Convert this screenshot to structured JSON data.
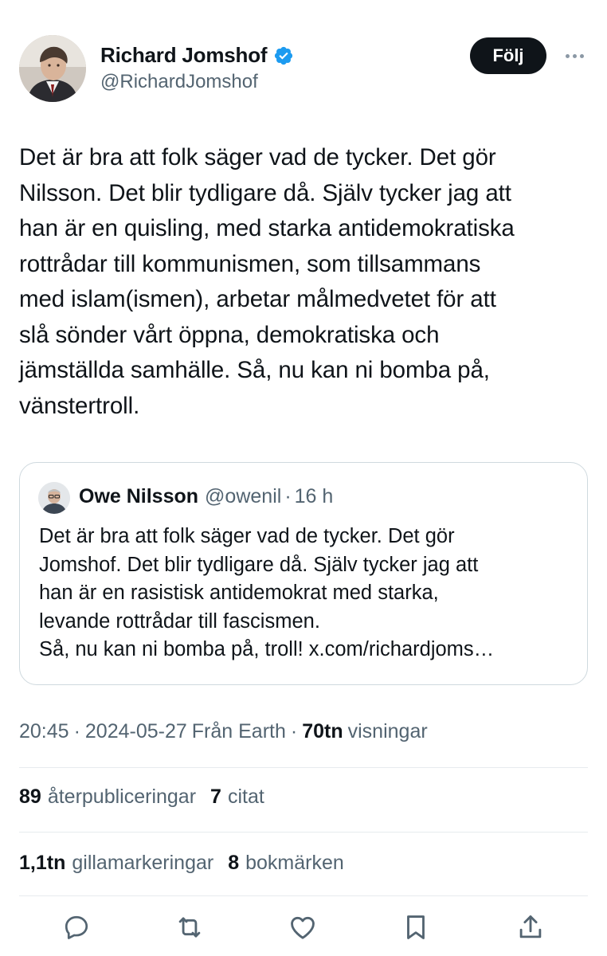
{
  "author": {
    "display_name": "Richard Jomshof",
    "handle": "@RichardJomshof",
    "verified": true,
    "verified_color": "#1d9bf0",
    "follow_label": "Följ"
  },
  "tweet": {
    "text": "Det är bra att folk säger vad de tycker. Det gör\nNilsson. Det blir tydligare då. Själv tycker jag att\nhan är en quisling, med starka antidemokratiska\nrottrådar till kommunismen, som tillsammans\nmed islam(ismen), arbetar målmedvetet för att\nslå sönder vårt öppna, demokratiska och\njämställda samhälle. Så, nu kan ni bomba på,\nvänstertroll."
  },
  "quote": {
    "display_name": "Owe Nilsson",
    "handle": "@owenil",
    "separator": "·",
    "time": "16 h",
    "text": "Det är bra att folk säger vad de tycker. Det gör\nJomshof. Det blir tydligare då. Själv tycker jag att\nhan är en rasistisk antidemokrat med starka,\nlevande rottrådar till fascismen.\nSå, nu kan ni bomba på, troll! x.com/richardjoms…"
  },
  "meta": {
    "time": "20:45",
    "sep1": "·",
    "date": "2024-05-27",
    "source": "Från Earth",
    "sep2": "·",
    "views_count": "70tn",
    "views_label": "visningar"
  },
  "stats": {
    "reposts_count": "89",
    "reposts_label": "återpubliceringar",
    "quotes_count": "7",
    "quotes_label": "citat",
    "likes_count": "1,1tn",
    "likes_label": "gillamarkeringar",
    "bookmarks_count": "8",
    "bookmarks_label": "bokmärken"
  },
  "actions": [
    "reply-icon",
    "repost-icon",
    "like-icon",
    "bookmark-icon",
    "share-icon"
  ],
  "colors": {
    "text": "#0f1419",
    "secondary": "#536471",
    "border": "#cfd9de",
    "divider": "#e7ebee",
    "icon": "#536471"
  }
}
